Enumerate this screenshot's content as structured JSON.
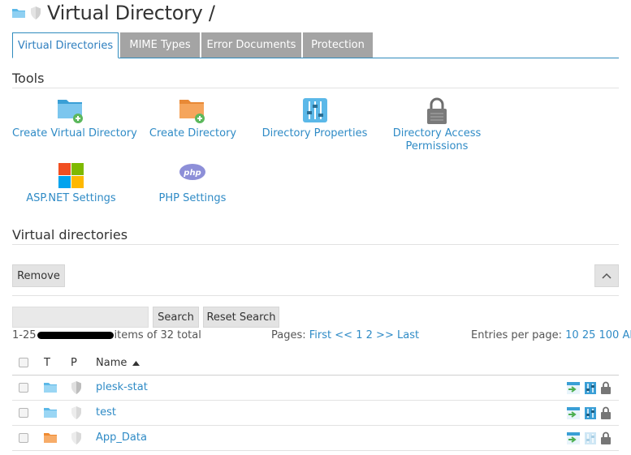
{
  "page": {
    "title": "Virtual Directory /"
  },
  "tabs": [
    {
      "label": "Virtual Directories",
      "active": true
    },
    {
      "label": "MIME Types",
      "active": false
    },
    {
      "label": "Error Documents",
      "active": false
    },
    {
      "label": "Protection",
      "active": false
    }
  ],
  "tools": {
    "heading": "Tools",
    "items": [
      {
        "label": "Create Virtual Directory",
        "icon": "folder-add-icon"
      },
      {
        "label": "Create Directory",
        "icon": "folder-add-icon"
      },
      {
        "label": "Directory Properties",
        "icon": "sliders-icon"
      },
      {
        "label_line1": "Directory Access",
        "label_line2": "Permissions",
        "icon": "lock-icon"
      },
      {
        "label": "ASP.NET Settings",
        "icon": "windows-logo-icon"
      },
      {
        "label": "PHP Settings",
        "icon": "php-icon"
      }
    ]
  },
  "vdirs": {
    "heading": "Virtual directories",
    "remove_label": "Remove",
    "search_label": "Search",
    "reset_label": "Reset Search",
    "search_value": "",
    "items_prefix": "1-25",
    "items_suffix": "items of 32 total",
    "pages_label": "Pages:",
    "first_label": "First",
    "prev_label": "<<",
    "page1": "1",
    "page2": "2",
    "next_label": ">>",
    "last_label": "Last",
    "entries_label": "Entries per page:",
    "entries_10": "10",
    "entries_25": "25",
    "entries_100": "100",
    "entries_all": "All"
  },
  "table": {
    "col_t": "T",
    "col_p": "P",
    "col_name": "Name",
    "rows": [
      {
        "name": "plesk-stat",
        "folder_color": "#5bb8e8"
      },
      {
        "name": "test",
        "folder_color": "#5bb8e8"
      },
      {
        "name": "App_Data",
        "folder_color": "#f39a4a"
      }
    ]
  },
  "colors": {
    "accent": "#2f8bbd",
    "link": "#2f8bc6",
    "tab_inactive": "#a4a4a4"
  }
}
